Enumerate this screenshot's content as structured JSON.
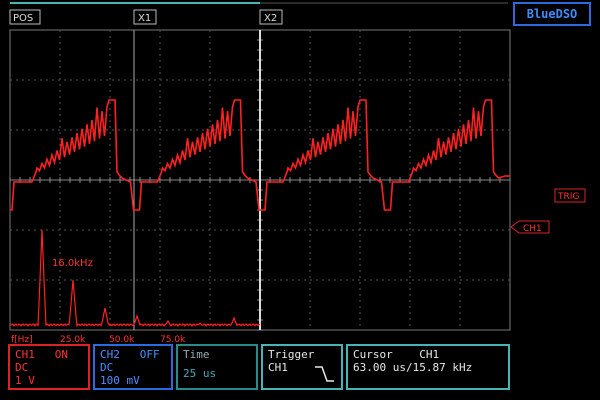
{
  "brand": "BlueDSO",
  "top_buttons": {
    "pos": "POS",
    "x1": "X1",
    "x2": "X2"
  },
  "markers": {
    "trig": "TRIG",
    "ch1": "CH1"
  },
  "fft": {
    "axis_label": "f[Hz]",
    "ticks": [
      "25.0k",
      "50.0k",
      "75.0k"
    ],
    "peak_label": "16.0kHz"
  },
  "ch1": {
    "header": "CH1   ON",
    "coupling": "DC",
    "scale": "1 V"
  },
  "ch2": {
    "header": "CH2   OFF",
    "coupling": "DC",
    "scale": "100 mV"
  },
  "time": {
    "header": "Time",
    "value": "25 us"
  },
  "trigger": {
    "header": "Trigger",
    "source": "CH1"
  },
  "cursor": {
    "header": "Cursor    CH1",
    "value": "63.00 us/15.87 kHz"
  },
  "colors": {
    "ch1": "#ff2020",
    "ch2": "#3f8cff",
    "teal": "#48b4b4",
    "grid": "#666666"
  }
}
